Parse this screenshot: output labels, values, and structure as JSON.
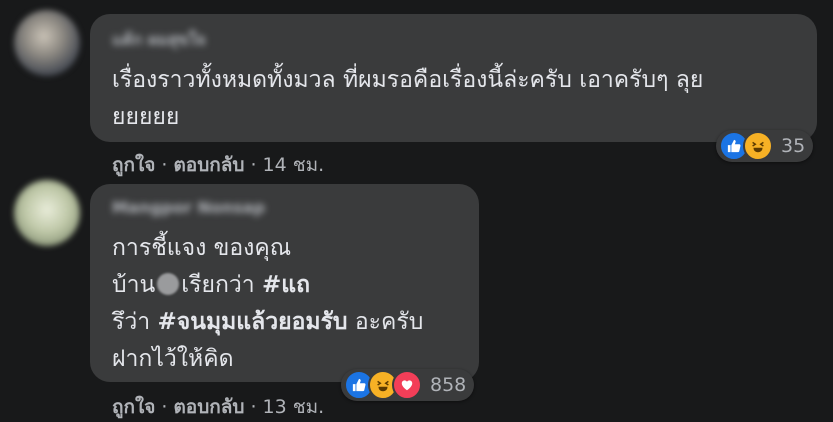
{
  "comments": [
    {
      "author": "แต้ก ผมสุขใจ",
      "lines": [
        "เรื่องราวทั้งหมดทั้งมวล ที่ผมรอคือเรื่องนี้ล่ะครับ เอาครับๆ ลุย",
        "ยยยยย"
      ],
      "reaction_count": "35",
      "like_label": "ถูกใจ",
      "reply_label": "ตอบกลับ",
      "time": "14 ชม."
    },
    {
      "author": "Mangpor Nonsap",
      "line1": "การชี้แจง ของคุณ",
      "line2_pre": "บ้าน",
      "line2_post": "เรียกว่า",
      "hashtag1": "#แถ",
      "line3_pre": "รึว่า",
      "hashtag2": "#จนมุมแล้วยอมรับ",
      "line3_post": "อะครับ",
      "line4": "ฝากไว้ให้คิด",
      "reaction_count": "858",
      "like_label": "ถูกใจ",
      "reply_label": "ตอบกลับ",
      "time": "13 ชม."
    }
  ],
  "icons": {
    "like": "thumbs-up",
    "haha": "laughing-face",
    "love": "heart"
  },
  "colors": {
    "like": "#1b74e4",
    "haha": "#f7b125",
    "love": "#f33e58"
  }
}
